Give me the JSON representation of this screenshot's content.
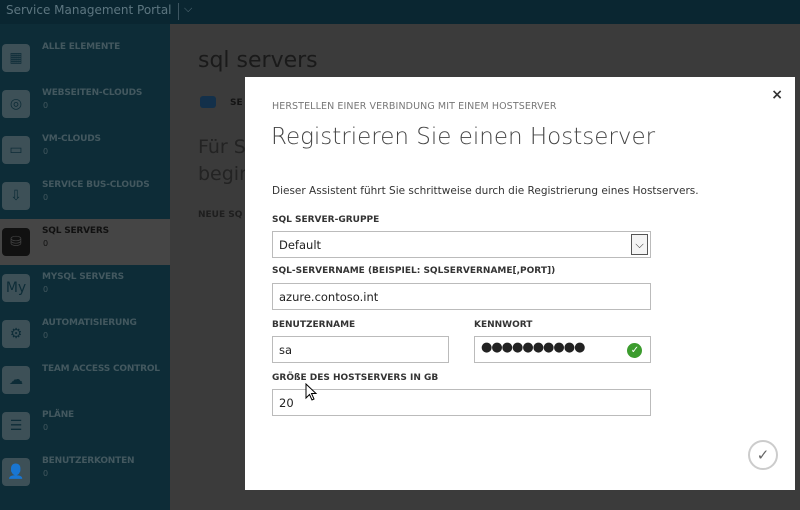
{
  "topbar": {
    "title": "Service Management Portal",
    "menu_icon": "chevron-down-icon"
  },
  "sidebar": {
    "items": [
      {
        "label": "ALLE ELEMENTE",
        "count": "",
        "icon": "grid-icon",
        "glyph": "▦"
      },
      {
        "label": "WEBSEITEN-CLOUDS",
        "count": "0",
        "icon": "website-cloud-icon",
        "glyph": "◎"
      },
      {
        "label": "VM-CLOUDS",
        "count": "0",
        "icon": "monitor-icon",
        "glyph": "▭"
      },
      {
        "label": "SERVICE BUS-CLOUDS",
        "count": "0",
        "icon": "service-bus-icon",
        "glyph": "⇩"
      },
      {
        "label": "SQL SERVERS",
        "count": "0",
        "icon": "database-icon",
        "glyph": "⛁",
        "selected": true
      },
      {
        "label": "MYSQL SERVERS",
        "count": "0",
        "icon": "mysql-database-icon",
        "glyph": "My"
      },
      {
        "label": "AUTOMATISIERUNG",
        "count": "0",
        "icon": "gear-icon",
        "glyph": "⚙"
      },
      {
        "label": "TEAM ACCESS CONTROL",
        "count": "",
        "icon": "cloud-folder-icon",
        "glyph": "☁"
      },
      {
        "label": "PLÄNE",
        "count": "0",
        "icon": "list-icon",
        "glyph": "☰"
      },
      {
        "label": "BENUTZERKONTEN",
        "count": "0",
        "icon": "user-icon",
        "glyph": "👤"
      }
    ]
  },
  "main": {
    "title": "sql servers",
    "tab": "SE",
    "intro": "Für S",
    "intro2": "begin",
    "new_label": "NEUE SQ"
  },
  "modal": {
    "subtitle": "HERSTELLEN EINER VERBINDUNG MIT EINEM HOSTSERVER",
    "title": "Registrieren Sie einen Hostserver",
    "description": "Dieser Assistent führt Sie schrittweise durch die Registrierung eines Hostservers.",
    "group_label": "SQL SERVER-GRUPPE",
    "group_value": "Default",
    "servername_label": "SQL-SERVERNAME (BEISPIEL: SQLSERVERNAME[,PORT])",
    "servername_value": "azure.contoso.int",
    "username_label": "BENUTZERNAME",
    "username_value": "sa",
    "password_label": "KENNWORT",
    "password_mask": "●●●●●●●●●●",
    "size_label": "GRÖßE DES HOSTSERVERS IN GB",
    "size_value": "20",
    "close": "×",
    "done": "✓",
    "valid": "✓"
  }
}
